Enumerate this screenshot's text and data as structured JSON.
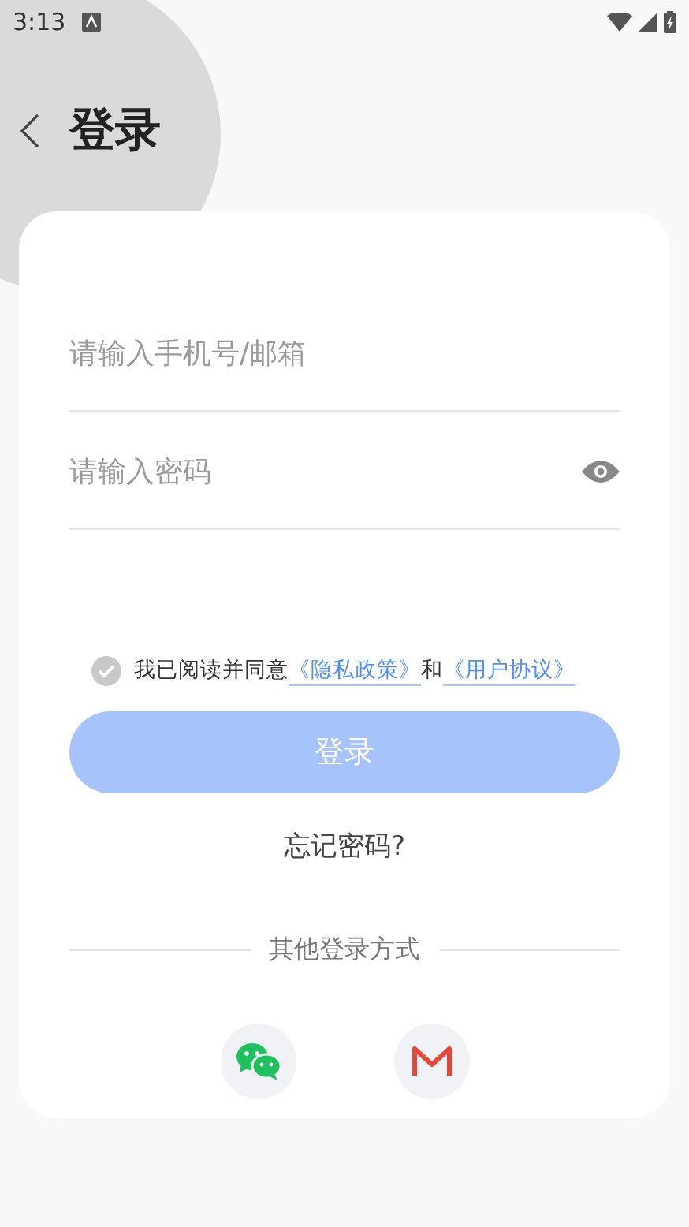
{
  "status_bar": {
    "time": "3:13"
  },
  "header": {
    "title": "登录"
  },
  "fields": [
    {
      "placeholder": "请输入手机号/邮箱",
      "kind": "text"
    },
    {
      "placeholder": "请输入密码",
      "kind": "password"
    }
  ],
  "agreement": {
    "checked": false,
    "text": "我已阅读并同意",
    "links": [
      "《隐私政策》",
      "《用户协议》"
    ],
    "joiner": "和"
  },
  "login_button": {
    "label": "登录",
    "disabled": true
  },
  "forgot_password": "忘记密码?",
  "other_login": {
    "label": "其他登录方式",
    "options": [
      {
        "kind": "wechat"
      },
      {
        "kind": "mail"
      }
    ]
  }
}
